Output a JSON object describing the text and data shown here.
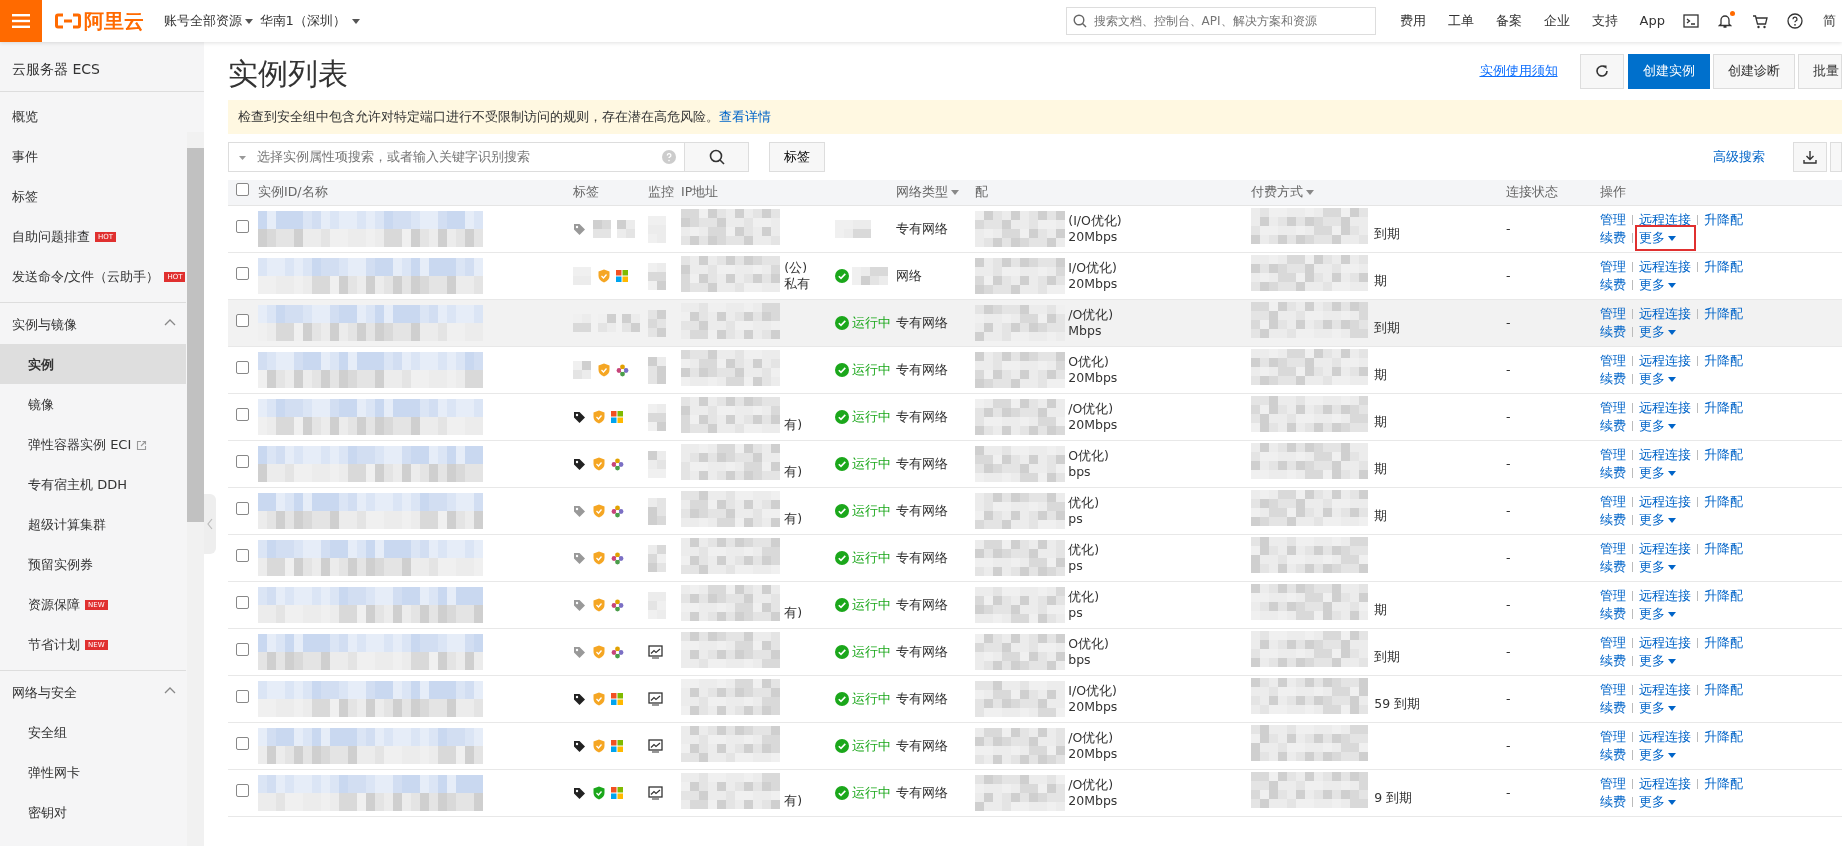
{
  "topbar": {
    "logo": "阿里云",
    "account": "账号全部资源",
    "region": "华南1（深圳）",
    "search": {
      "placeholder": "搜索文档、控制台、API、解决方案和资源"
    },
    "links": [
      "费用",
      "工单",
      "备案",
      "企业",
      "支持",
      "App"
    ],
    "language": "简",
    "notification_dot": true
  },
  "sidebar": {
    "title": "云服务器 ECS",
    "items": [
      {
        "label": "概览"
      },
      {
        "label": "事件"
      },
      {
        "label": "标签"
      },
      {
        "label": "自助问题排查",
        "badge": "HOT"
      },
      {
        "label": "发送命令/文件（云助手）",
        "badge": "HOT"
      }
    ],
    "groups": [
      {
        "label": "实例与镜像",
        "expanded": true,
        "children": [
          {
            "label": "实例",
            "selected": true
          },
          {
            "label": "镜像",
            "selected": false
          },
          {
            "label": "弹性容器实例 ECI",
            "selected": false,
            "external": true
          },
          {
            "label": "专有宿主机 DDH",
            "selected": false
          },
          {
            "label": "超级计算集群",
            "selected": false
          },
          {
            "label": "预留实例券",
            "selected": false
          },
          {
            "label": "资源保障",
            "selected": false,
            "badge": "NEW"
          },
          {
            "label": "节省计划",
            "selected": false,
            "badge": "NEW"
          }
        ]
      },
      {
        "label": "网络与安全",
        "expanded": true,
        "children": [
          {
            "label": "安全组",
            "selected": false
          },
          {
            "label": "弹性网卡",
            "selected": false
          },
          {
            "label": "密钥对",
            "selected": false
          }
        ]
      }
    ]
  },
  "page": {
    "title": "实例列表",
    "notice_link": "实例使用须知",
    "buttons": [
      {
        "label": "创建实例",
        "primary": true
      },
      {
        "label": "创建诊断",
        "primary": false
      },
      {
        "label": "批量",
        "primary": false
      }
    ],
    "alert": {
      "text": "检查到安全组中包含允许对特定端口进行不受限制访问的规则，存在潜在高危风险。",
      "link": "查看详情"
    },
    "search": {
      "placeholder": "选择实例属性项搜索，或者输入关键字识别搜索"
    },
    "tag_button": "标签",
    "advanced_search": "高级搜索"
  },
  "table": {
    "select_all_checked": false,
    "columns": [
      "实例ID/名称",
      "标签",
      "监控",
      "IP地址",
      "网络类型",
      "配",
      "付费方式",
      "连接状态",
      "操作"
    ],
    "rows": [
      {
        "checked": false,
        "hovered": false,
        "icons": [
          {
            "kind": "tag",
            "dark": false
          },
          {
            "kind": "pixelated"
          },
          {
            "kind": "pixelated"
          },
          {
            "kind": "pixelated"
          }
        ],
        "network": "专有网络",
        "config": [
          "(I/O优化)",
          "20Mbps"
        ],
        "billing": "到期",
        "connection": "-",
        "actions": [
          "管理",
          "远程连接",
          "升降配",
          "续费",
          "更多"
        ],
        "more_highlighted": true
      },
      {
        "checked": false,
        "hovered": false,
        "icons": [
          {
            "kind": "pixelated"
          },
          {
            "kind": "shield",
            "green": false
          },
          {
            "kind": "windows"
          },
          {
            "kind": "pixelated"
          }
        ],
        "ip_note_top": "(公)",
        "ip_note": "私有",
        "status_icon": true,
        "network": "网络",
        "config": [
          "I/O优化)",
          "20Mbps"
        ],
        "billing": "期",
        "connection": "-",
        "actions": [
          "管理",
          "远程连接",
          "升降配",
          "续费",
          "更多"
        ],
        "more_highlighted": false
      },
      {
        "checked": false,
        "hovered": true,
        "icons": [
          {
            "kind": "pixelated"
          },
          {
            "kind": "pixelated"
          },
          {
            "kind": "pixelated"
          },
          {
            "kind": "pixelated"
          }
        ],
        "status": "运行中",
        "network": "专有网络",
        "config": [
          "/O优化)",
          "Mbps"
        ],
        "billing": "到期",
        "connection": "-",
        "actions": [
          "管理",
          "远程连接",
          "升降配",
          "续费",
          "更多"
        ],
        "more_highlighted": false
      },
      {
        "checked": false,
        "hovered": false,
        "icons": [
          {
            "kind": "pixelated"
          },
          {
            "kind": "shield",
            "green": false
          },
          {
            "kind": "flower"
          },
          {
            "kind": "pixelated"
          }
        ],
        "status": "运行中",
        "network": "专有网络",
        "config": [
          "O优化)",
          "20Mbps"
        ],
        "billing": "期",
        "connection": "-",
        "actions": [
          "管理",
          "远程连接",
          "升降配",
          "续费",
          "更多"
        ],
        "more_highlighted": false
      },
      {
        "checked": false,
        "hovered": false,
        "icons": [
          {
            "kind": "tag",
            "dark": true
          },
          {
            "kind": "shield",
            "green": false
          },
          {
            "kind": "windows"
          },
          {
            "kind": "pixelated"
          }
        ],
        "ip_note": "有)",
        "status": "运行中",
        "network": "专有网络",
        "config": [
          "/O优化)",
          "20Mbps"
        ],
        "billing": "期",
        "connection": "-",
        "actions": [
          "管理",
          "远程连接",
          "升降配",
          "续费",
          "更多"
        ],
        "more_highlighted": false
      },
      {
        "checked": false,
        "hovered": false,
        "icons": [
          {
            "kind": "tag",
            "dark": true
          },
          {
            "kind": "shield",
            "green": false
          },
          {
            "kind": "flower"
          },
          {
            "kind": "pixelated"
          }
        ],
        "ip_note": "有)",
        "status": "运行中",
        "network": "专有网络",
        "config": [
          "O优化)",
          "bps"
        ],
        "billing": "期",
        "connection": "-",
        "actions": [
          "管理",
          "远程连接",
          "升降配",
          "续费",
          "更多"
        ],
        "more_highlighted": false
      },
      {
        "checked": false,
        "hovered": false,
        "icons": [
          {
            "kind": "tag",
            "dark": false
          },
          {
            "kind": "shield",
            "green": false
          },
          {
            "kind": "flower"
          },
          {
            "kind": "pixelated"
          }
        ],
        "ip_note": "有)",
        "status": "运行中",
        "network": "专有网络",
        "config": [
          "优化)",
          "ps"
        ],
        "billing": "期",
        "connection": "-",
        "actions": [
          "管理",
          "远程连接",
          "升降配",
          "续费",
          "更多"
        ],
        "more_highlighted": false
      },
      {
        "checked": false,
        "hovered": false,
        "icons": [
          {
            "kind": "tag",
            "dark": false
          },
          {
            "kind": "shield",
            "green": false
          },
          {
            "kind": "flower"
          },
          {
            "kind": "pixelated"
          }
        ],
        "status": "运行中",
        "network": "专有网络",
        "config": [
          "优化)",
          "ps"
        ],
        "connection": "-",
        "actions": [
          "管理",
          "远程连接",
          "升降配",
          "续费",
          "更多"
        ],
        "more_highlighted": false
      },
      {
        "checked": false,
        "hovered": false,
        "icons": [
          {
            "kind": "tag",
            "dark": false
          },
          {
            "kind": "shield",
            "green": false
          },
          {
            "kind": "flower"
          },
          {
            "kind": "pixelated"
          }
        ],
        "ip_note": "有)",
        "status": "运行中",
        "network": "专有网络",
        "config": [
          "优化)",
          "ps"
        ],
        "billing": "期",
        "connection": "-",
        "actions": [
          "管理",
          "远程连接",
          "升降配",
          "续费",
          "更多"
        ],
        "more_highlighted": false
      },
      {
        "checked": false,
        "hovered": false,
        "icons": [
          {
            "kind": "tag",
            "dark": false
          },
          {
            "kind": "shield",
            "green": false
          },
          {
            "kind": "flower"
          },
          {
            "kind": "monitor"
          }
        ],
        "status": "运行中",
        "network": "专有网络",
        "config": [
          "O优化)",
          "bps"
        ],
        "billing": "到期",
        "connection": "-",
        "actions": [
          "管理",
          "远程连接",
          "升降配",
          "续费",
          "更多"
        ],
        "more_highlighted": false
      },
      {
        "checked": false,
        "hovered": false,
        "icons": [
          {
            "kind": "tag",
            "dark": true
          },
          {
            "kind": "shield",
            "green": false
          },
          {
            "kind": "windows"
          },
          {
            "kind": "monitor"
          }
        ],
        "status": "运行中",
        "network": "专有网络",
        "config": [
          "I/O优化)",
          "20Mbps"
        ],
        "billing": "59 到期",
        "connection": "-",
        "actions": [
          "管理",
          "远程连接",
          "升降配",
          "续费",
          "更多"
        ],
        "more_highlighted": false
      },
      {
        "checked": false,
        "hovered": false,
        "icons": [
          {
            "kind": "tag",
            "dark": true
          },
          {
            "kind": "shield",
            "green": false
          },
          {
            "kind": "windows"
          },
          {
            "kind": "monitor"
          }
        ],
        "status": "运行中",
        "network": "专有网络",
        "config": [
          "/O优化)",
          "20Mbps"
        ],
        "connection": "-",
        "actions": [
          "管理",
          "远程连接",
          "升降配",
          "续费",
          "更多"
        ],
        "more_highlighted": false
      },
      {
        "checked": false,
        "hovered": false,
        "icons": [
          {
            "kind": "tag",
            "dark": true
          },
          {
            "kind": "shield",
            "green": true
          },
          {
            "kind": "windows"
          },
          {
            "kind": "monitor"
          }
        ],
        "ip_note": "有)",
        "status": "运行中",
        "network": "专有网络",
        "config": [
          "/O优化)",
          "20Mbps"
        ],
        "billing": "9 到期",
        "connection": "-",
        "actions": [
          "管理",
          "远程连接",
          "升降配",
          "续费",
          "更多"
        ],
        "more_highlighted": false
      }
    ]
  }
}
